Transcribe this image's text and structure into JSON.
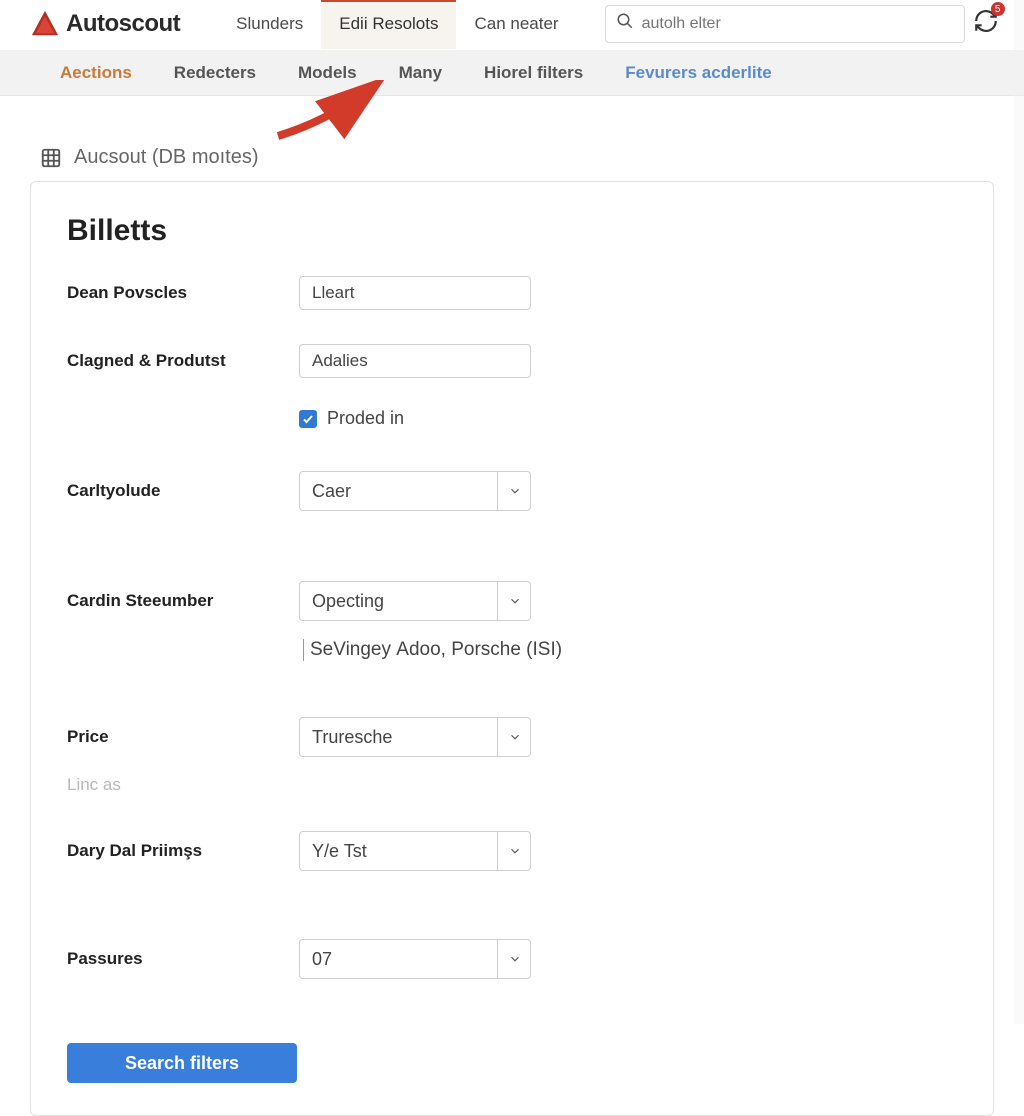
{
  "brand": {
    "name": "Autoscout"
  },
  "topnav": {
    "items": [
      "Slunders",
      "Edii Resolots",
      "Can neater"
    ],
    "active_index": 1
  },
  "search": {
    "placeholder": "autolh elter"
  },
  "notif_badge": "5",
  "subnav": {
    "items": [
      {
        "label": "Aections",
        "style": "accent"
      },
      {
        "label": "Redecters",
        "style": ""
      },
      {
        "label": "Models",
        "style": ""
      },
      {
        "label": "Many",
        "style": ""
      },
      {
        "label": "Hiorel filters",
        "style": ""
      },
      {
        "label": "Fevurers acderlite",
        "style": "blue"
      }
    ]
  },
  "breadcrumb": "Aucsout (DB moıteѕ)",
  "form": {
    "title": "Billetts",
    "rows": {
      "dean_povscles": {
        "label": "Dean Povscles",
        "value": "Lleart"
      },
      "clagned_product": {
        "label": "Clagned & Produtst",
        "value": "Adalies"
      },
      "proded_in": {
        "label": "Proded in",
        "checked": true
      },
      "carltyolude": {
        "label": "Carltyolude",
        "value": "Caer"
      },
      "cardin_steeumber": {
        "label": "Cardin Steeumber",
        "value": "Opecting",
        "helper": "SeVingeу Adoo, Porsche (ISI)"
      },
      "price": {
        "label": "Price",
        "value": "Truresche",
        "sublabel": "Linc as"
      },
      "dary_dal_priims": {
        "label": "Dary Dal Priimşs",
        "value": "Y/e Tst"
      },
      "passures": {
        "label": "Passures",
        "value": "07"
      }
    },
    "submit": "Search filters"
  }
}
